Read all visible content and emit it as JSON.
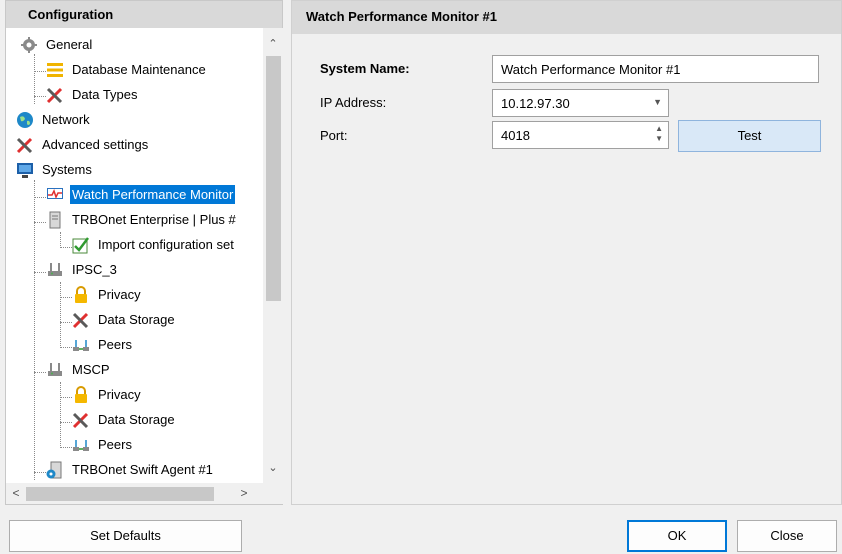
{
  "left_header": "Configuration",
  "right_header": "Watch Performance Monitor #1",
  "tree": {
    "items": [
      {
        "label": "General",
        "icon": "gear-icon"
      },
      {
        "label": "Database Maintenance",
        "icon": "database-maintenance-icon"
      },
      {
        "label": "Data Types",
        "icon": "tools-icon"
      },
      {
        "label": "Network",
        "icon": "globe-icon"
      },
      {
        "label": "Advanced settings",
        "icon": "tools-icon"
      },
      {
        "label": "Systems",
        "icon": "systems-monitor-icon"
      },
      {
        "label": "Watch Performance Monitor",
        "icon": "performance-monitor-icon"
      },
      {
        "label": "TRBOnet Enterprise | Plus #",
        "icon": "server-icon"
      },
      {
        "label": "Import configuration set",
        "icon": "import-check-icon"
      },
      {
        "label": "IPSC_3",
        "icon": "repeater-icon"
      },
      {
        "label": "Privacy",
        "icon": "lock-icon"
      },
      {
        "label": "Data Storage",
        "icon": "tools-icon"
      },
      {
        "label": "Peers",
        "icon": "peers-icon"
      },
      {
        "label": "MSCP",
        "icon": "repeater-icon"
      },
      {
        "label": "Privacy",
        "icon": "lock-icon"
      },
      {
        "label": "Data Storage",
        "icon": "tools-icon"
      },
      {
        "label": "Peers",
        "icon": "peers-icon"
      },
      {
        "label": "TRBOnet Swift Agent #1",
        "icon": "swift-agent-icon"
      }
    ]
  },
  "form": {
    "system_name_label": "System Name:",
    "system_name_value": "Watch Performance Monitor #1",
    "ip_label": "IP Address:",
    "ip_value": "10.12.97.30",
    "port_label": "Port:",
    "port_value": "4018",
    "test_label": "Test"
  },
  "buttons": {
    "set_defaults": "Set Defaults",
    "ok": "OK",
    "close": "Close"
  },
  "colors": {
    "selection": "#0078d7",
    "header_bg": "#d9d9d9",
    "test_button_bg": "#d9e8f7"
  }
}
